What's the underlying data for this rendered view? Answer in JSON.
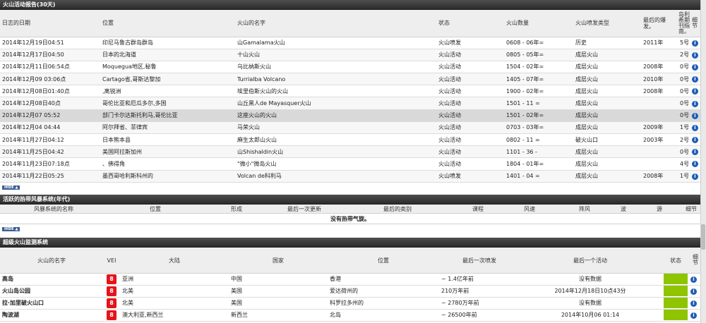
{
  "volcano_report": {
    "title": "火山活动报告(30天)",
    "headers": [
      "日志的日期",
      "位置",
      "火山的名字",
      "状态",
      "火山数量",
      "火山喷发类型",
      "最后的爆发。",
      "岛利希期刊指南。",
      "细节"
    ],
    "rows": [
      {
        "date": "2014年12月19日04:51",
        "location": "印尼马鲁古群岛群岛",
        "name": "山Gamalama火山",
        "status": "火山喷发",
        "number": "0608 - 06年=",
        "type": "历史",
        "last": "2011年",
        "ref": "5号"
      },
      {
        "date": "2014年12月17日04:50",
        "location": "日本的北海道",
        "name": "十山火山",
        "status": "火山活动",
        "number": "0805 - 05年=",
        "type": "成层火山",
        "last": "",
        "ref": "2号"
      },
      {
        "date": "2014年12月11日06:54点",
        "location": "Moquegua地区,秘鲁",
        "name": "乌比纳斯火山",
        "status": "火山活动",
        "number": "1504 - 02年=",
        "type": "成层火山",
        "last": "2008年",
        "ref": "0号"
      },
      {
        "date": "2014年12月09 03:06点",
        "location": "Cartago省,哥斯达黎加",
        "name": "Turrialba Volcano",
        "status": "火山活动",
        "number": "1405 - 07年=",
        "type": "成层火山",
        "last": "2010年",
        "ref": "0号"
      },
      {
        "date": "2014年12月08日01:40点",
        "location": ",离锐洲",
        "name": "埃里伯斯火山的火山",
        "status": "火山活动",
        "number": "1900 - 02年=",
        "type": "成层火山",
        "last": "2008年",
        "ref": "0号"
      },
      {
        "date": "2014年12月08日40点",
        "location": "哥伦比亚和厄瓜多尔,多国",
        "name": "山丘黑人de Mayasquer火山",
        "status": "火山活动",
        "number": "1501 - 11 =",
        "type": "成层火山",
        "last": "",
        "ref": "0号"
      },
      {
        "date": "2014年12月07 05:52",
        "location": "部门卡尔达斯托利马,哥伦比亚",
        "name": "这座火山的火山",
        "status": "火山活动",
        "number": "1501 - 02年=",
        "type": "成层火山",
        "last": "",
        "ref": "0号"
      },
      {
        "date": "2014年12月04 04:44",
        "location": "阿尔拜省、菲律宾",
        "name": "马荣火山",
        "status": "火山活动",
        "number": "0703 - 03年=",
        "type": "成层火山",
        "last": "2009年",
        "ref": "1号"
      },
      {
        "date": "2014年11月27日04:12",
        "location": "日本熊本县",
        "name": "麻生太郎山火山",
        "status": "火山活动",
        "number": "0802 - 11 =",
        "type": "破火山口",
        "last": "2003年",
        "ref": "2号"
      },
      {
        "date": "2014年11月25日04:42",
        "location": "美国阿拉斯加州",
        "name": "山Shishaldin火山",
        "status": "火山活动",
        "number": "1101 - 36 -",
        "type": "成层火山",
        "last": "",
        "ref": "0号"
      },
      {
        "date": "2014年11月23日07:18点",
        "location": "、佛得角",
        "name": "\"微小\"微岛火山",
        "status": "火山活动",
        "number": "1804 - 01年=",
        "type": "成层火山",
        "last": "",
        "ref": "4号"
      },
      {
        "date": "2014年11月22日05:25",
        "location": "墨西哥哈利斯科州的",
        "name": "Volcan de科利马",
        "status": "火山喷发",
        "number": "1401 - 04 =",
        "type": "成层火山",
        "last": "2008年",
        "ref": "1号"
      }
    ],
    "hide_label": "HIDE"
  },
  "storm": {
    "title": "活跃的热带风暴系统(年代)",
    "headers": [
      "风暴系统的名称",
      "位置",
      "形成",
      "最后一次更新",
      "最后的类别",
      "课程",
      "风速",
      "阵风",
      "波",
      "源",
      "细节"
    ],
    "empty_message": "没有热带气旋。",
    "hide_label": "HIDE"
  },
  "supervolcano": {
    "title": "超级火山监测系统",
    "headers": [
      "火山的名字",
      "VEI",
      "大陆",
      "国家",
      "位置",
      "最后一次喷发",
      "最后一个活动",
      "状态",
      "细节"
    ],
    "rows": [
      {
        "name": "高岛",
        "vei": "8",
        "continent": "亚洲",
        "country": "中国",
        "location": "香港",
        "last_eruption": "~ 1.4亿年前",
        "last_activity": "没有数据"
      },
      {
        "name": "火山岛公园",
        "vei": "8",
        "continent": "北美",
        "country": "美国",
        "location": "爱达荷州的",
        "last_eruption": "210万年前",
        "last_activity": "2014年12月18日10点43分"
      },
      {
        "name": "拉·加里破火山口",
        "vei": "8",
        "continent": "北美",
        "country": "美国",
        "location": "科罗拉多州的",
        "last_eruption": "~ 2780万年前",
        "last_activity": "没有数据"
      },
      {
        "name": "陶波湖",
        "vei": "8",
        "continent": "澳大利亚,新西兰",
        "country": "新西兰",
        "location": "北岛",
        "last_eruption": "~ 26500年前",
        "last_activity": "2014年10月06 01:14"
      }
    ]
  },
  "colors": {
    "header_bg": "#2b2b2b",
    "vei_red": "#e4141a",
    "status_green": "#8fc400",
    "info_blue": "#1c5eb4"
  },
  "icons": {
    "info": "info-icon",
    "hide": "triangle-up-icon"
  }
}
